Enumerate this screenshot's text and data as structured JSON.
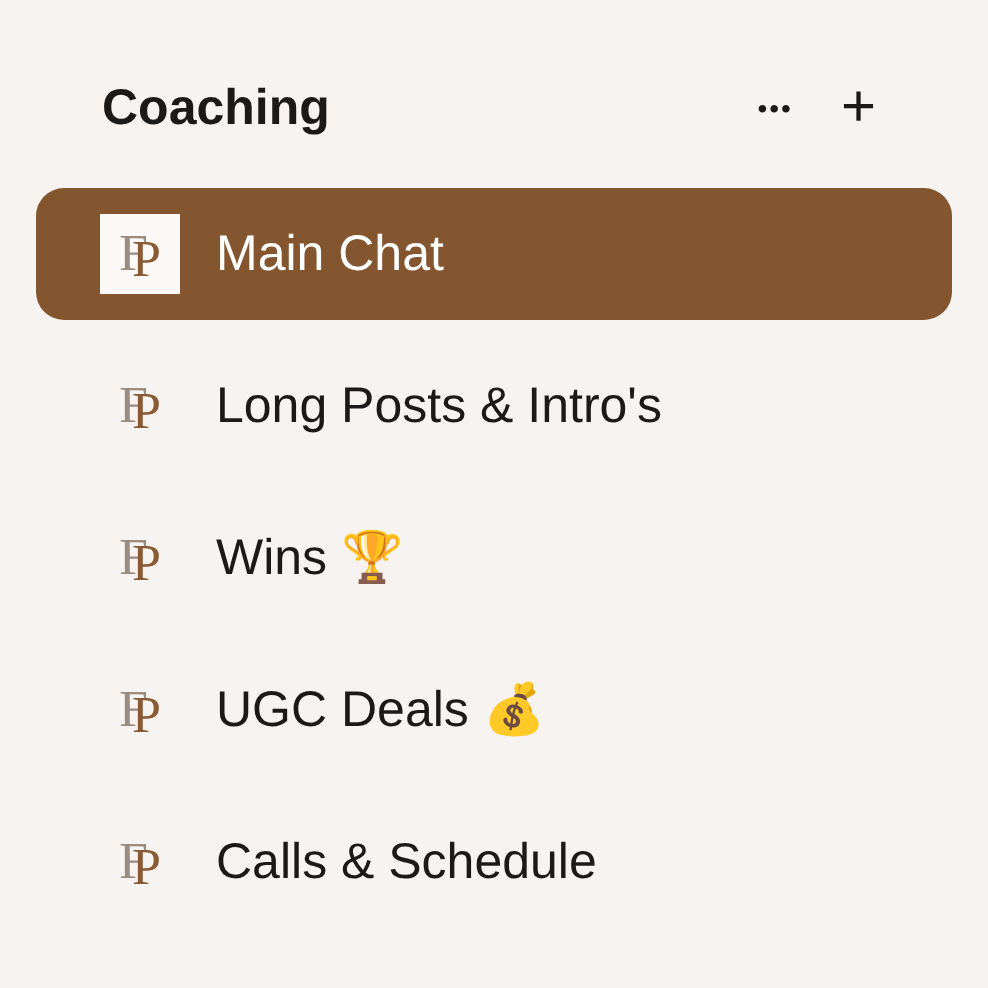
{
  "section": {
    "title": "Coaching",
    "more_icon": "•••",
    "add_icon": "+"
  },
  "channels": [
    {
      "name": "Main Chat",
      "logo": "FP",
      "selected": true
    },
    {
      "name": "Long Posts & Intro's",
      "logo": "FP",
      "selected": false
    },
    {
      "name": "Wins 🏆",
      "logo": "FP",
      "selected": false
    },
    {
      "name": "UGC Deals 💰",
      "logo": "FP",
      "selected": false
    },
    {
      "name": "Calls & Schedule",
      "logo": "FP",
      "selected": false
    }
  ]
}
